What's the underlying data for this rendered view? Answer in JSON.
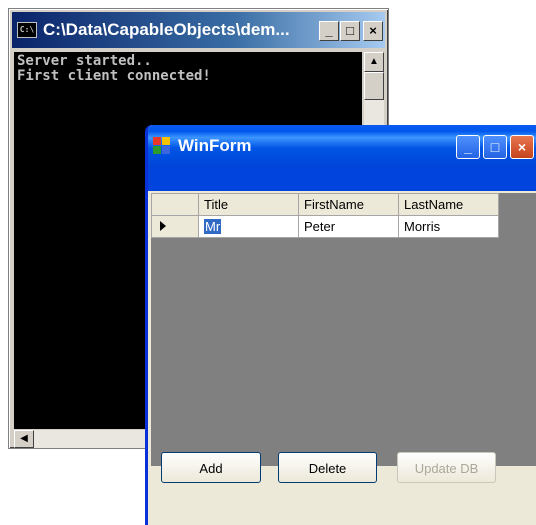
{
  "console": {
    "title": "C:\\Data\\CapableObjects\\dem...",
    "icon_text": "C:\\",
    "output_lines": [
      "Server started..",
      "First client connected!"
    ],
    "title_buttons": {
      "minimize": "_",
      "maximize": "□",
      "close": "×"
    }
  },
  "winform": {
    "title": "WinForm",
    "title_buttons": {
      "minimize": "_",
      "maximize": "□",
      "close": "×"
    },
    "grid": {
      "columns": [
        "Title",
        "FirstName",
        "LastName"
      ],
      "rows": [
        {
          "title": "Mr",
          "first_name": "Peter",
          "last_name": "Morris"
        }
      ]
    },
    "buttons": {
      "add": "Add",
      "delete": "Delete",
      "update": "Update DB"
    }
  },
  "colors": {
    "console_titlebar": "#0a246a",
    "xp_titlebar": "#0055e5",
    "selection": "#316ac5",
    "grid_background": "#808080"
  }
}
